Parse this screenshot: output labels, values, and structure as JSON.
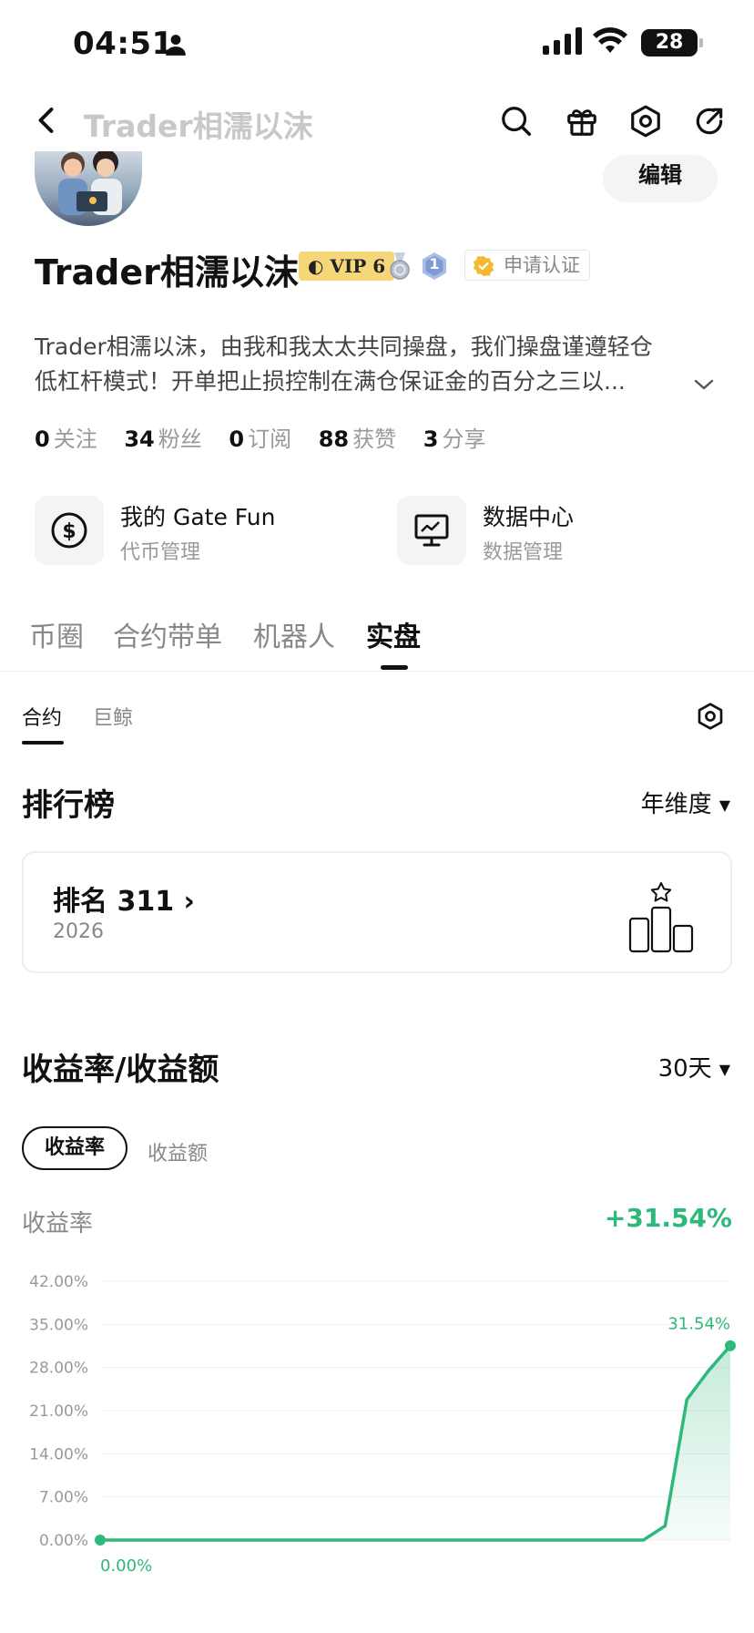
{
  "status_bar": {
    "time": "04:51",
    "battery": "28"
  },
  "nav": {
    "title": "Trader相濡以沫"
  },
  "profile": {
    "edit_label": "编辑",
    "username": "Trader相濡以沫",
    "vip_badge": "VIP 6",
    "level_badge": "1",
    "cert_label": "申请认证",
    "bio_line1": "Trader相濡以沫，由我和我太太共同操盘，我们操盘谨遵轻仓",
    "bio_line2": "低杠杆模式！开单把止损控制在满仓保证金的百分之三以...",
    "stats": [
      {
        "num": "0",
        "label": "关注"
      },
      {
        "num": "34",
        "label": "粉丝"
      },
      {
        "num": "0",
        "label": "订阅"
      },
      {
        "num": "88",
        "label": "获赞"
      },
      {
        "num": "3",
        "label": "分享"
      }
    ]
  },
  "cards": [
    {
      "title": "我的 Gate Fun",
      "subtitle": "代币管理",
      "icon": "dollar-circle-icon"
    },
    {
      "title": "数据中心",
      "subtitle": "数据管理",
      "icon": "monitor-chart-icon"
    }
  ],
  "tabs": [
    "币圈",
    "合约带单",
    "机器人",
    "实盘"
  ],
  "active_tab": "实盘",
  "subtabs": [
    "合约",
    "巨鲸"
  ],
  "leaderboard": {
    "title": "排行榜",
    "period": "年维度",
    "rank_label": "排名 311",
    "year": "2026"
  },
  "returns": {
    "title": "收益率/收益额",
    "period": "30天",
    "pill_active": "收益率",
    "pill_inactive": "收益额",
    "metric_label": "收益率",
    "metric_value": "+31.54%"
  },
  "colors": {
    "positive": "#2eb87a",
    "vip": "#f5d77a"
  },
  "chart_data": {
    "type": "area",
    "y_ticks": [
      "42.00%",
      "35.00%",
      "28.00%",
      "21.00%",
      "14.00%",
      "7.00%",
      "0.00%"
    ],
    "ylim": [
      0,
      42
    ],
    "x": [
      0,
      1,
      2,
      3,
      4,
      5,
      6,
      7,
      8,
      9,
      10,
      11,
      12,
      13,
      14,
      15,
      16,
      17,
      18,
      19,
      20,
      21,
      22,
      23,
      24,
      25,
      26,
      27,
      28,
      29
    ],
    "values": [
      0,
      0,
      0,
      0,
      0,
      0,
      0,
      0,
      0,
      0,
      0,
      0,
      0,
      0,
      0,
      0,
      0,
      0,
      0,
      0,
      0,
      0,
      0,
      0,
      0,
      0,
      2.3,
      22.8,
      27.5,
      31.54
    ],
    "start_label": "0.00%",
    "end_label": "31.54%",
    "grid": true
  }
}
